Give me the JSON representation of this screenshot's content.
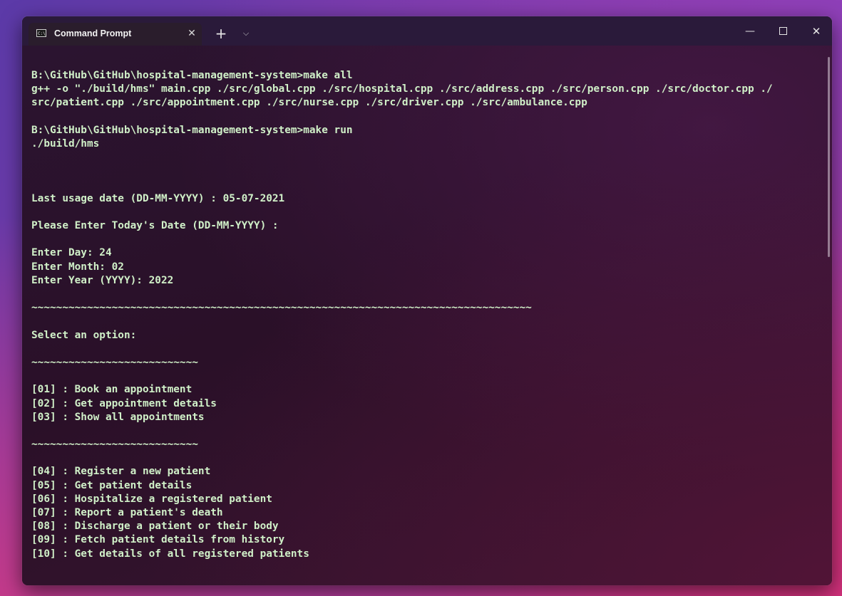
{
  "tab": {
    "icon_glyph": "C:\\_",
    "icon": "terminal-icon",
    "title": "Command Prompt",
    "close_glyph": "✕"
  },
  "titlebar": {
    "new_tab_glyph": "+",
    "dropdown_glyph": "⌵",
    "minimize_glyph": "—",
    "close_glyph": "✕"
  },
  "colors": {
    "terminal_text": "#d0f0c8",
    "titlebar_bg": "#2a1a3a"
  },
  "terminal": {
    "lines": [
      "B:\\GitHub\\GitHub\\hospital-management-system>make all",
      "g++ -o \"./build/hms\" main.cpp ./src/global.cpp ./src/hospital.cpp ./src/address.cpp ./src/person.cpp ./src/doctor.cpp ./",
      "src/patient.cpp ./src/appointment.cpp ./src/nurse.cpp ./src/driver.cpp ./src/ambulance.cpp",
      "",
      "B:\\GitHub\\GitHub\\hospital-management-system>make run",
      "./build/hms",
      "",
      "",
      "",
      "Last usage date (DD-MM-YYYY) : 05-07-2021",
      "",
      "Please Enter Today's Date (DD-MM-YYYY) :",
      "",
      "Enter Day: 24",
      "Enter Month: 02",
      "Enter Year (YYYY): 2022",
      "",
      "~~~~~~~~~~~~~~~~~~~~~~~~~~~~~~~~~~~~~~~~~~~~~~~~~~~~~~~~~~~~~~~~~~~~~~~~~~~~~~~~~",
      "",
      "Select an option:",
      "",
      "~~~~~~~~~~~~~~~~~~~~~~~~~~~",
      "",
      "[01] : Book an appointment",
      "[02] : Get appointment details",
      "[03] : Show all appointments",
      "",
      "~~~~~~~~~~~~~~~~~~~~~~~~~~~",
      "",
      "[04] : Register a new patient",
      "[05] : Get patient details",
      "[06] : Hospitalize a registered patient",
      "[07] : Report a patient's death",
      "[08] : Discharge a patient or their body",
      "[09] : Fetch patient details from history",
      "[10] : Get details of all registered patients"
    ]
  }
}
